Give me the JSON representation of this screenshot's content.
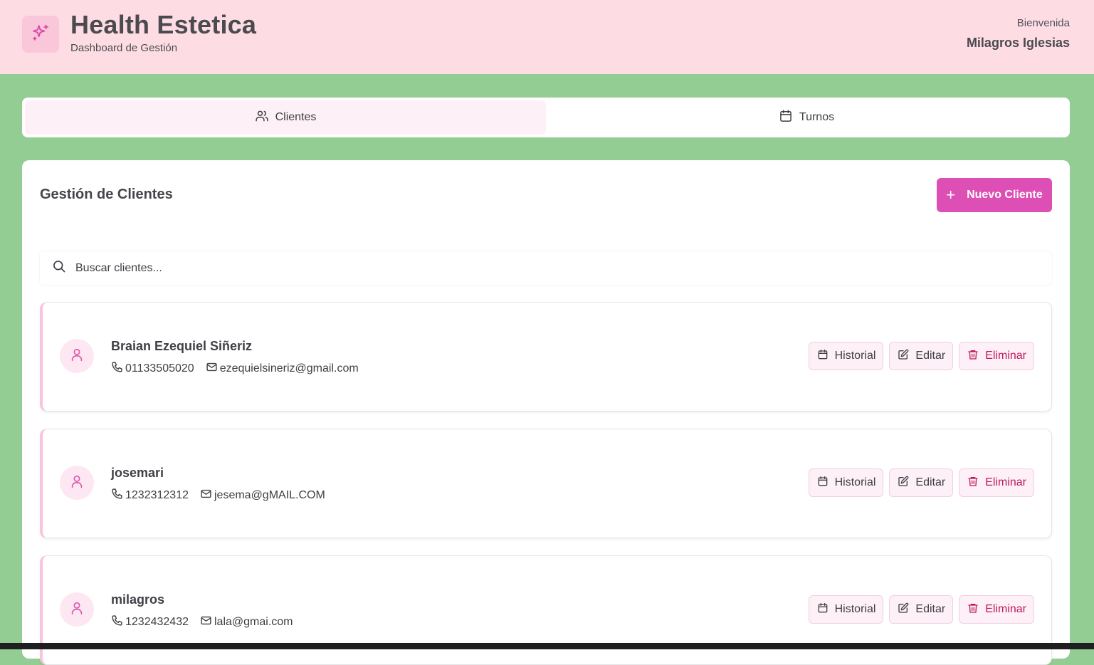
{
  "header": {
    "title": "Health Estetica",
    "subtitle": "Dashboard de Gestión",
    "welcome": "Bienvenida",
    "user_name": "Milagros Iglesias",
    "logo_icon": "sparkles-icon"
  },
  "tabs": [
    {
      "label": "Clientes",
      "icon": "users-icon",
      "active": true
    },
    {
      "label": "Turnos",
      "icon": "calendar-icon",
      "active": false
    }
  ],
  "panel": {
    "title": "Gestión de Clientes",
    "new_button": "Nuevo Cliente",
    "search_placeholder": "Buscar clientes..."
  },
  "actions": {
    "history": "Historial",
    "edit": "Editar",
    "delete": "Eliminar"
  },
  "clients": [
    {
      "name": "Braian Ezequiel Siñeriz",
      "phone": "01133505020",
      "email": "ezequielsineriz@gmail.com"
    },
    {
      "name": "josemari",
      "phone": "1232312312",
      "email": "jesema@gMAIL.COM"
    },
    {
      "name": "milagros",
      "phone": "1232432432",
      "email": "lala@gmai.com"
    }
  ],
  "colors": {
    "header_bg": "#fddde3",
    "page_bg": "#94cd93",
    "accent": "#dd4fb4",
    "danger": "#be185d"
  }
}
